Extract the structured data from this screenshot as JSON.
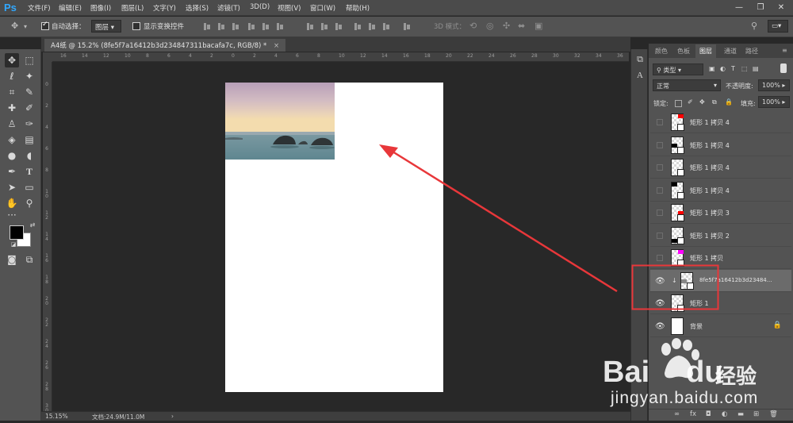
{
  "app": {
    "logo": "Ps",
    "menu": [
      "文件(F)",
      "编辑(E)",
      "图像(I)",
      "图层(L)",
      "文字(Y)",
      "选择(S)",
      "滤镜(T)",
      "3D(D)",
      "视图(V)",
      "窗口(W)",
      "帮助(H)"
    ],
    "window_buttons": [
      "minimize-icon",
      "restore-icon",
      "close-icon"
    ]
  },
  "options_bar": {
    "tool_icon": "move-icon",
    "auto_select_label": "自动选择：",
    "auto_select_checked": true,
    "auto_select_target": "图层",
    "show_transform_label": "显示变换控件",
    "show_transform_checked": false,
    "mode_3d_label": "3D 模式："
  },
  "document": {
    "tab_title": "A4纸 @ 15.2% (8fe5f7a16412b3d234847311bacafa7c, RGB/8) *",
    "tab_close": "×",
    "ruler_top_ticks": [
      "16",
      "14",
      "12",
      "10",
      "8",
      "6",
      "4",
      "2",
      "0",
      "2",
      "4",
      "6",
      "8",
      "10",
      "12",
      "14",
      "16",
      "18",
      "20",
      "22",
      "24",
      "26",
      "28",
      "30",
      "32",
      "34",
      "36"
    ],
    "ruler_left_ticks": [
      "0",
      "2",
      "4",
      "6",
      "8",
      "1 0",
      "1 2",
      "1 4",
      "1 6",
      "1 8",
      "2 0",
      "2 2",
      "2 4",
      "2 6",
      "2 8",
      "3 0"
    ]
  },
  "statusbar": {
    "zoom": "15.15%",
    "doc_info": "文档:24.9M/11.0M",
    "arrow": "›"
  },
  "panel": {
    "tabs": [
      "颜色",
      "色板",
      "图层",
      "通道",
      "路径"
    ],
    "active_tab": "图层",
    "filter_kind": "类型",
    "blend_mode": "正常",
    "opacity_label": "不透明度:",
    "opacity_value": "100%",
    "lock_label": "锁定:",
    "fill_label": "填充:",
    "fill_value": "100%",
    "layers": [
      {
        "name": "矩形 1 拷贝 4",
        "visible": false,
        "swatch": "#ff0000"
      },
      {
        "name": "矩形 1 拷贝 4",
        "visible": false,
        "swatch": "#000000"
      },
      {
        "name": "矩形 1 拷贝 4",
        "visible": false,
        "swatch": "#ff00ff"
      },
      {
        "name": "矩形 1 拷贝 4",
        "visible": false,
        "swatch": "#000000"
      },
      {
        "name": "矩形 1 拷贝 3",
        "visible": false,
        "swatch": "#ff0000"
      },
      {
        "name": "矩形 1 拷贝 2",
        "visible": false,
        "swatch": "#000000"
      },
      {
        "name": "矩形 1 拷贝",
        "visible": false,
        "swatch": "#ff00ff"
      },
      {
        "name": "8fe5f7a16412b3d23484...",
        "visible": true,
        "swatch": "#888888",
        "selected": true,
        "clipped": true
      },
      {
        "name": "矩形 1",
        "visible": true,
        "swatch": "#555555"
      },
      {
        "name": "背景",
        "visible": true,
        "swatch": "#ffffff",
        "locked": true
      }
    ],
    "bottom_icons": [
      "link-icon",
      "fx-icon",
      "mask-icon",
      "adjustment-icon",
      "group-folder-icon",
      "new-layer-icon",
      "trash-icon"
    ],
    "bottom_labels": [
      "∞",
      "fx",
      "◘",
      "◐",
      "▬",
      "⊞",
      "🗑"
    ]
  },
  "watermark": {
    "brand": "Bai",
    "brand_end": "du",
    "brand_cn": "经验",
    "url": "jingyan.baidu.com"
  },
  "colors": {
    "annotation_red": "#e8373a",
    "foreground": "#000000",
    "background": "#ffffff"
  }
}
